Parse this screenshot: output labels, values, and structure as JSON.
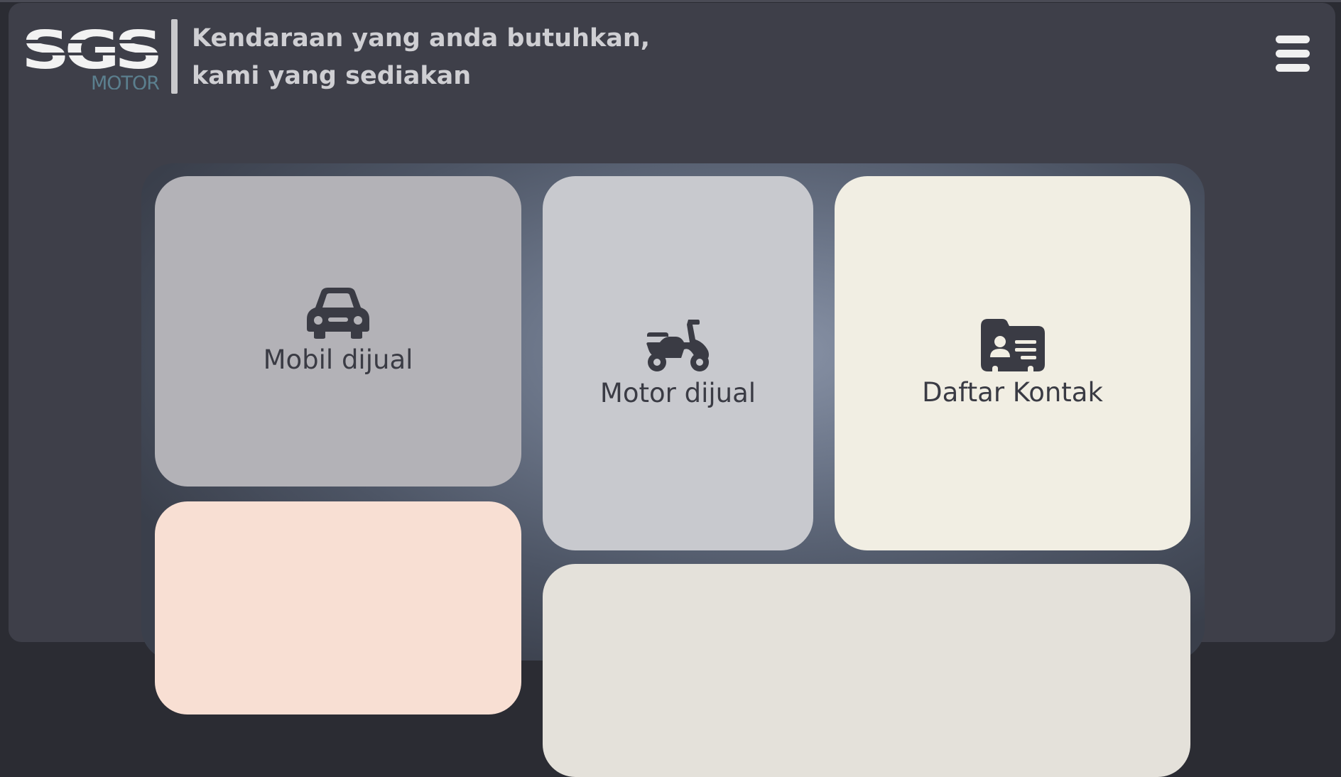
{
  "header": {
    "logo_text": "SGS",
    "logo_subtext": "MOTOR",
    "tagline_line1": "Kendaraan yang anda butuhkan,",
    "tagline_line2": "kami yang sediakan"
  },
  "menu": {
    "icon": "hamburger-menu-icon"
  },
  "tiles": [
    {
      "label": "Mobil dijual",
      "icon": "car-icon",
      "color": "#b3b2b7"
    },
    {
      "label": "Motor dijual",
      "icon": "scooter-icon",
      "color": "#c8c9ce"
    },
    {
      "label": "Daftar Kontak",
      "icon": "contact-card-icon",
      "color": "#f1eee3"
    },
    {
      "label": "",
      "color": "#f8dfd3"
    },
    {
      "label": "",
      "color": "#e4e1da"
    }
  ],
  "colors": {
    "background": "#3e3f49",
    "text_dark": "#3a3b44",
    "logo_accent": "#5b7f8e"
  }
}
